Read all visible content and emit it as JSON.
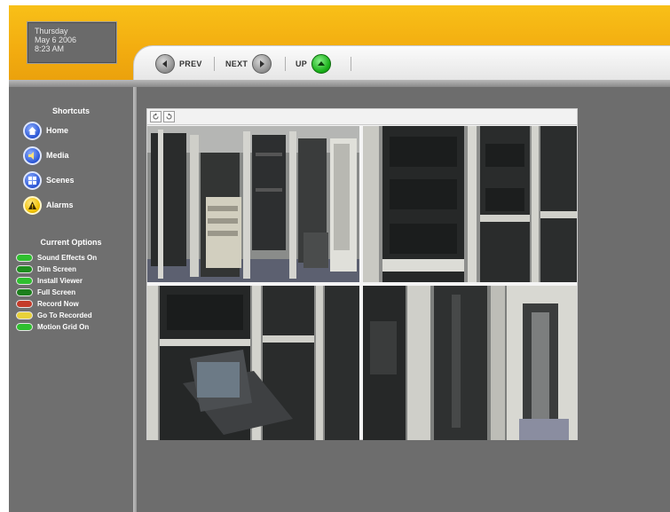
{
  "header": {
    "date": {
      "day": "Thursday",
      "date": "May 6 2006",
      "time": "8:23 AM"
    },
    "nav": {
      "prev_label": "PREV",
      "next_label": "NEXT",
      "up_label": "UP"
    }
  },
  "sidebar": {
    "shortcuts_title": "Shortcuts",
    "shortcuts": [
      {
        "label": "Home",
        "icon": "home-icon"
      },
      {
        "label": "Media",
        "icon": "speaker-icon"
      },
      {
        "label": "Scenes",
        "icon": "scenes-icon"
      },
      {
        "label": "Alarms",
        "icon": "alarm-icon"
      }
    ],
    "options_title": "Current Options",
    "options": [
      {
        "label": "Sound Effects On",
        "icon": "sound-icon",
        "color": "#2fbf2f"
      },
      {
        "label": "Dim Screen",
        "icon": "dim-icon",
        "color": "#1f8f1f"
      },
      {
        "label": "Install Viewer",
        "icon": "install-icon",
        "color": "#2fbf2f"
      },
      {
        "label": "Full Screen",
        "icon": "fullscreen-icon",
        "color": "#1d7f1d"
      },
      {
        "label": "Record Now",
        "icon": "record-icon",
        "color": "#c43b2a"
      },
      {
        "label": "Go To Recorded",
        "icon": "recorded-icon",
        "color": "#e8d23a"
      },
      {
        "label": "Motion Grid On",
        "icon": "motion-grid-icon",
        "color": "#2fbf2f"
      }
    ]
  },
  "viewer": {
    "cameras": [
      "camera-feed-1",
      "camera-feed-2",
      "camera-feed-3",
      "camera-feed-4"
    ]
  },
  "colors": {
    "header_orange": "#f3ad10",
    "panel_gray": "#6d6d6d",
    "accent_green": "#19b019",
    "accent_blue": "#2a55d4"
  }
}
